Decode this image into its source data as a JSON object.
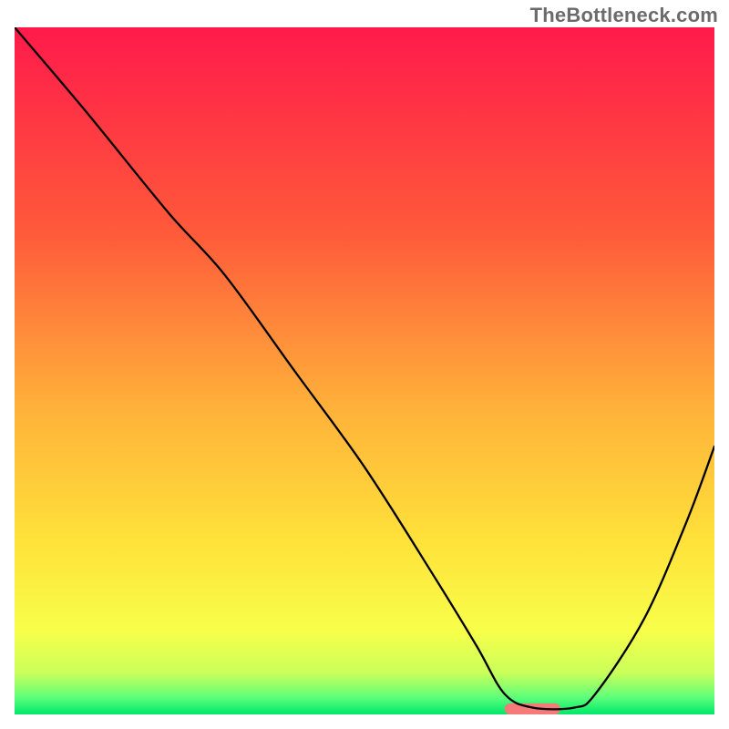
{
  "watermark": "TheBottleneck.com",
  "chart_data": {
    "type": "line",
    "title": "",
    "xlabel": "",
    "ylabel": "",
    "xlim": [
      0,
      100
    ],
    "ylim": [
      0,
      100
    ],
    "gradient_stops": [
      {
        "offset": 0,
        "color": "#ff1a4b"
      },
      {
        "offset": 0.3,
        "color": "#ff5a3a"
      },
      {
        "offset": 0.55,
        "color": "#ffb03a"
      },
      {
        "offset": 0.75,
        "color": "#ffe23a"
      },
      {
        "offset": 0.88,
        "color": "#f7ff4a"
      },
      {
        "offset": 0.94,
        "color": "#c9ff5a"
      },
      {
        "offset": 0.975,
        "color": "#5eff7a"
      },
      {
        "offset": 1.0,
        "color": "#00e86b"
      }
    ],
    "series": [
      {
        "name": "curve",
        "color": "#000000",
        "stroke_width": 2.3,
        "x": [
          0,
          10,
          22,
          30,
          40,
          50,
          60,
          66,
          70,
          74,
          80,
          83,
          90,
          96,
          100
        ],
        "y": [
          100,
          88,
          73,
          64,
          50,
          36,
          20,
          10,
          3,
          1,
          1,
          3,
          14,
          28,
          39
        ]
      }
    ],
    "marker": {
      "name": "target-marker",
      "color": "#f77a7a",
      "x_start": 70,
      "x_end": 78,
      "y": 0.8,
      "height": 1.6
    }
  }
}
